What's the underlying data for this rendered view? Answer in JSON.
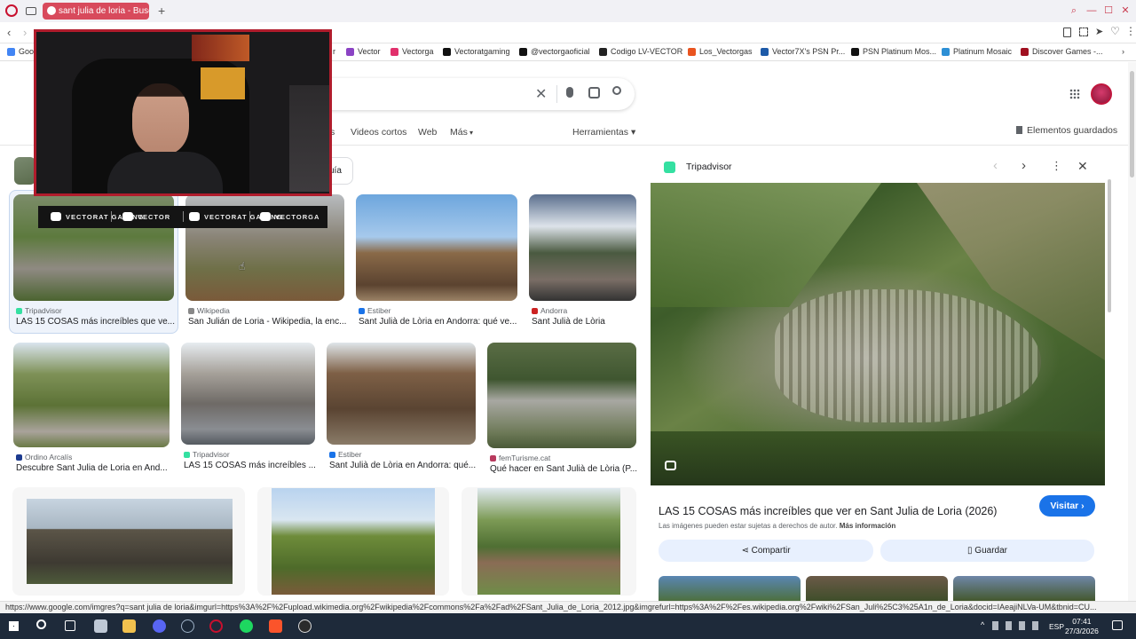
{
  "browser": {
    "tab_title": "sant julia de loria - Buscar",
    "bookmarks": [
      {
        "label": "Goog",
        "color": "#4285f4"
      },
      {
        "label": "r",
        "color": "#888"
      },
      {
        "label": "Vector",
        "color": "#8b43c4"
      },
      {
        "label": "Vectorga",
        "color": "#e1306c"
      },
      {
        "label": "Vectoratgaming",
        "color": "#111"
      },
      {
        "label": "@vectorgaoficial",
        "color": "#111"
      },
      {
        "label": "Codigo LV-VECTOR",
        "color": "#222"
      },
      {
        "label": "Los_Vectorgas",
        "color": "#e95420"
      },
      {
        "label": "Vector7X's PSN Pr...",
        "color": "#1d5aa8"
      },
      {
        "label": "PSN Platinum Mos...",
        "color": "#111"
      },
      {
        "label": "Platinum Mosaic",
        "color": "#2d8fd5"
      },
      {
        "label": "Discover Games -...",
        "color": "#a01020"
      }
    ],
    "status_url": "https://www.google.com/imgres?q=sant julia de loria&imgurl=https%3A%2F%2Fupload.wikimedia.org%2Fwikipedia%2Fcommons%2Fa%2Fad%2FSant_Julia_de_Loria_2012.jpg&imgrefurl=https%3A%2F%2Fes.wikipedia.org%2Fwiki%2FSan_Juli%25C3%25A1n_de_Loria&docid=IAeajiNLVa-UM&tbnid=CU..."
  },
  "google": {
    "nav_tabs": [
      "s",
      "Videos cortos",
      "Web",
      "Más"
    ],
    "tools_label": "Herramientas",
    "saved_label": "Elementos guardados",
    "chip_label": "uía"
  },
  "results": [
    {
      "source": "Tripadvisor",
      "title": "LAS 15 COSAS más increíbles que ve...",
      "src_color": "#34e0a1"
    },
    {
      "source": "Wikipedia",
      "title": "San Julián de Loria - Wikipedia, la enc...",
      "src_color": "#888"
    },
    {
      "source": "Estiber",
      "title": "Sant Julià de Lòria en Andorra: qué ve...",
      "src_color": "#1a73e8"
    },
    {
      "source": "Andorra",
      "title": "Sant Julià de Lòria",
      "src_color": "#c22"
    },
    {
      "source": "Ordino Arcalís",
      "title": "Descubre Sant Julia de Loria en And...",
      "src_color": "#1d3b8f"
    },
    {
      "source": "Tripadvisor",
      "title": "LAS 15 COSAS más increíbles ...",
      "src_color": "#34e0a1"
    },
    {
      "source": "Estiber",
      "title": "Sant Julià de Lòria en Andorra: qué...",
      "src_color": "#1a73e8"
    },
    {
      "source": "femTurisme.cat",
      "title": "Qué hacer en Sant Julià de Lòria (P...",
      "src_color": "#b83a5e"
    }
  ],
  "panel": {
    "source": "Tripadvisor",
    "title": "LAS 15 COSAS más increíbles que ver en Sant Julia de Loria (2026)",
    "visit_label": "Visitar ›",
    "rights_text": "Las imágenes pueden estar sujetas a derechos de autor.",
    "more_info": "Más información",
    "share_label": "Compartir",
    "save_label": "Guardar"
  },
  "overlay": {
    "socials": [
      "VECTORAT GAMING",
      "VECTOR",
      "VECTORAT GAMING",
      "VECTORGA"
    ]
  },
  "taskbar": {
    "lang": "ESP",
    "time": "07:41",
    "date": "27/3/2026"
  }
}
